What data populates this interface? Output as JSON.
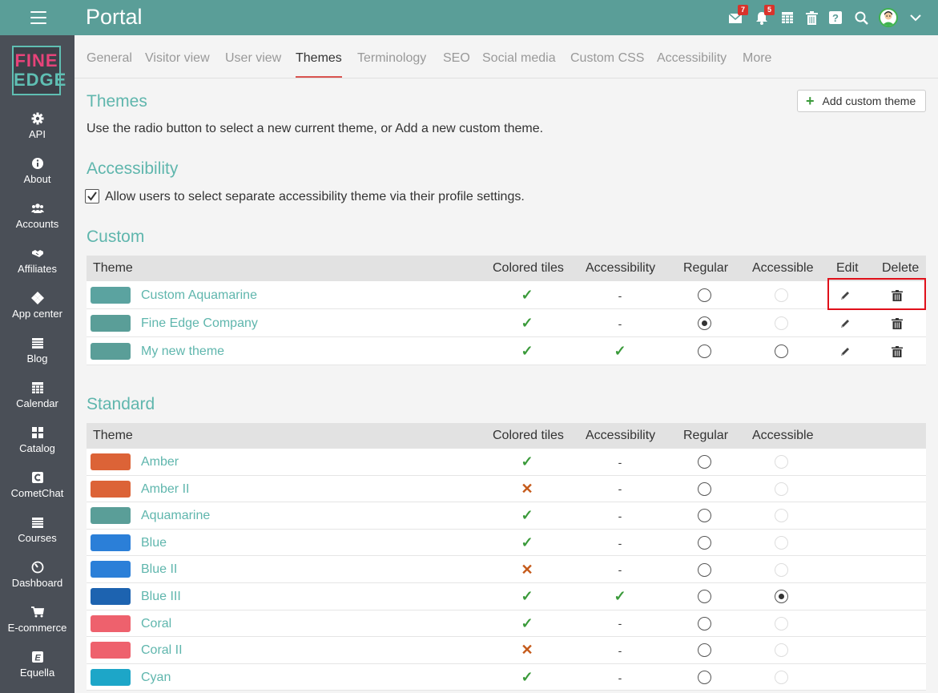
{
  "header": {
    "title": "Portal",
    "messages_badge": "7",
    "notifications_badge": "5",
    "icons": [
      "envelope-icon",
      "bell-icon",
      "calendar-icon",
      "trash-icon",
      "help-icon",
      "search-icon",
      "avatar",
      "chevron-down-icon"
    ]
  },
  "logo": {
    "line1": "FINE",
    "line2": "EDGE"
  },
  "sidebar": {
    "items": [
      {
        "label": "API",
        "icon": "gear-icon"
      },
      {
        "label": "About",
        "icon": "info-icon"
      },
      {
        "label": "Accounts",
        "icon": "users-icon"
      },
      {
        "label": "Affiliates",
        "icon": "handshake-icon"
      },
      {
        "label": "App center",
        "icon": "diamonds-icon"
      },
      {
        "label": "Blog",
        "icon": "calendar-icon"
      },
      {
        "label": "Calendar",
        "icon": "grid-calendar-icon"
      },
      {
        "label": "Catalog",
        "icon": "grid-icon"
      },
      {
        "label": "CometChat",
        "icon": "cometchat-icon"
      },
      {
        "label": "Courses",
        "icon": "calendar-icon"
      },
      {
        "label": "Dashboard",
        "icon": "gauge-icon"
      },
      {
        "label": "E-commerce",
        "icon": "cart-icon"
      },
      {
        "label": "Equella",
        "icon": "equella-icon"
      }
    ]
  },
  "tabs": [
    {
      "label": "General",
      "active": false
    },
    {
      "label": "Visitor view",
      "active": false
    },
    {
      "label": "User view",
      "active": false
    },
    {
      "label": "Themes",
      "active": true
    },
    {
      "label": "Terminology",
      "active": false
    },
    {
      "label": "SEO",
      "active": false
    },
    {
      "label": "Social media",
      "active": false
    },
    {
      "label": "Custom CSS",
      "active": false
    },
    {
      "label": "Accessibility",
      "active": false
    },
    {
      "label": "More",
      "active": false
    }
  ],
  "themes_section": {
    "heading": "Themes",
    "description": "Use the radio button to select a new current theme, or Add a new custom theme.",
    "add_button": "Add custom theme"
  },
  "accessibility_section": {
    "heading": "Accessibility",
    "checkbox_label": "Allow users to select separate accessibility theme via their profile settings.",
    "checked": true
  },
  "custom_section": {
    "heading": "Custom",
    "columns": [
      "Theme",
      "Colored tiles",
      "Accessibility",
      "Regular",
      "Accessible",
      "Edit",
      "Delete"
    ],
    "rows": [
      {
        "name": "Custom Aquamarine",
        "color": "#5ba3a0",
        "colored_tiles": "check",
        "accessibility": "dash",
        "regular": "unchecked",
        "accessible": "disabled"
      },
      {
        "name": "Fine Edge Company",
        "color": "#5a9e98",
        "colored_tiles": "check",
        "accessibility": "dash",
        "regular": "checked",
        "accessible": "disabled"
      },
      {
        "name": "My new theme",
        "color": "#5a9e98",
        "colored_tiles": "check",
        "accessibility": "check",
        "regular": "unchecked",
        "accessible": "unchecked"
      }
    ]
  },
  "standard_section": {
    "heading": "Standard",
    "columns": [
      "Theme",
      "Colored tiles",
      "Accessibility",
      "Regular",
      "Accessible"
    ],
    "rows": [
      {
        "name": "Amber",
        "color": "#dc6337",
        "colored_tiles": "check",
        "accessibility": "dash",
        "regular": "unchecked",
        "accessible": "disabled"
      },
      {
        "name": "Amber II",
        "color": "#dc6337",
        "colored_tiles": "cross",
        "accessibility": "dash",
        "regular": "unchecked",
        "accessible": "disabled"
      },
      {
        "name": "Aquamarine",
        "color": "#5a9e98",
        "colored_tiles": "check",
        "accessibility": "dash",
        "regular": "unchecked",
        "accessible": "disabled"
      },
      {
        "name": "Blue",
        "color": "#2b7fd8",
        "colored_tiles": "check",
        "accessibility": "dash",
        "regular": "unchecked",
        "accessible": "disabled"
      },
      {
        "name": "Blue II",
        "color": "#2b7fd8",
        "colored_tiles": "cross",
        "accessibility": "dash",
        "regular": "unchecked",
        "accessible": "disabled"
      },
      {
        "name": "Blue III",
        "color": "#1d63b0",
        "colored_tiles": "check",
        "accessibility": "check",
        "regular": "unchecked",
        "accessible": "checked"
      },
      {
        "name": "Coral",
        "color": "#ee616d",
        "colored_tiles": "check",
        "accessibility": "dash",
        "regular": "unchecked",
        "accessible": "disabled"
      },
      {
        "name": "Coral II",
        "color": "#ee616d",
        "colored_tiles": "cross",
        "accessibility": "dash",
        "regular": "unchecked",
        "accessible": "disabled"
      },
      {
        "name": "Cyan",
        "color": "#1da6c8",
        "colored_tiles": "check",
        "accessibility": "dash",
        "regular": "unchecked",
        "accessible": "disabled"
      }
    ]
  },
  "symbols": {
    "check": "✓",
    "cross": "✕",
    "dash": "-"
  }
}
